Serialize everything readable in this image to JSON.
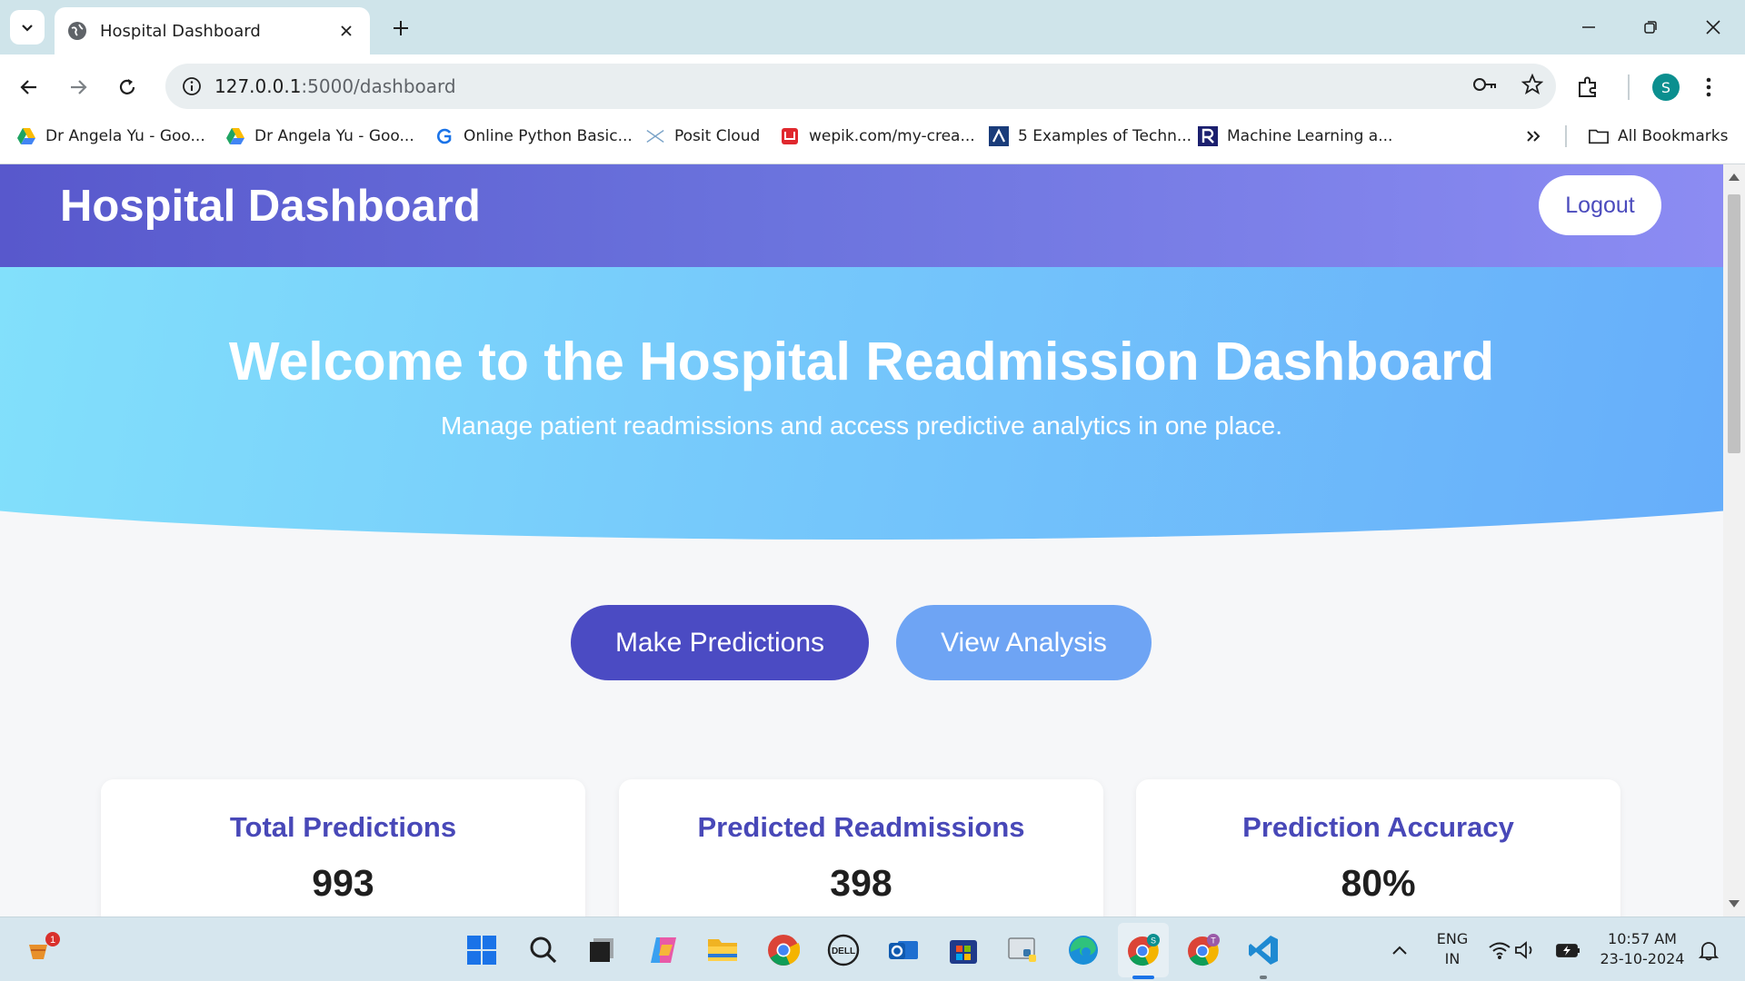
{
  "browser": {
    "tab_title": "Hospital Dashboard",
    "url_host": "127.0.0.1",
    "url_path": ":5000/dashboard",
    "profile_initial": "S",
    "bookmarks": [
      {
        "label": "Dr Angela Yu - Goo...",
        "icon": "google-drive-icon"
      },
      {
        "label": "Dr Angela Yu - Goo...",
        "icon": "google-drive-icon"
      },
      {
        "label": "Online Python Basic...",
        "icon": "g-icon"
      },
      {
        "label": "Posit Cloud",
        "icon": "posit-icon"
      },
      {
        "label": "wepik.com/my-crea...",
        "icon": "wepik-icon"
      },
      {
        "label": "5 Examples of Techn...",
        "icon": "a-icon"
      },
      {
        "label": "Machine Learning a...",
        "icon": "r-icon"
      }
    ],
    "all_bookmarks_label": "All Bookmarks"
  },
  "header": {
    "title": "Hospital Dashboard",
    "logout_label": "Logout"
  },
  "hero": {
    "title": "Welcome to the Hospital Readmission Dashboard",
    "subtitle": "Manage patient readmissions and access predictive analytics in one place."
  },
  "actions": {
    "predict_label": "Make Predictions",
    "analysis_label": "View Analysis"
  },
  "stats": [
    {
      "title": "Total Predictions",
      "value": "993"
    },
    {
      "title": "Predicted Readmissions",
      "value": "398"
    },
    {
      "title": "Prediction Accuracy",
      "value": "80%"
    }
  ],
  "taskbar": {
    "notification_badge": "1",
    "language": "ENG",
    "region": "IN",
    "time": "10:57 AM",
    "date": "23-10-2024"
  },
  "colors": {
    "header_gradient_start": "#5858cc",
    "header_gradient_end": "#8c8cf3",
    "hero_gradient_start": "#86e8fb",
    "hero_gradient_end": "#62a6fa",
    "primary_button": "#4b4bc3",
    "secondary_button": "#6ea4f4",
    "card_title": "#4848b8"
  }
}
